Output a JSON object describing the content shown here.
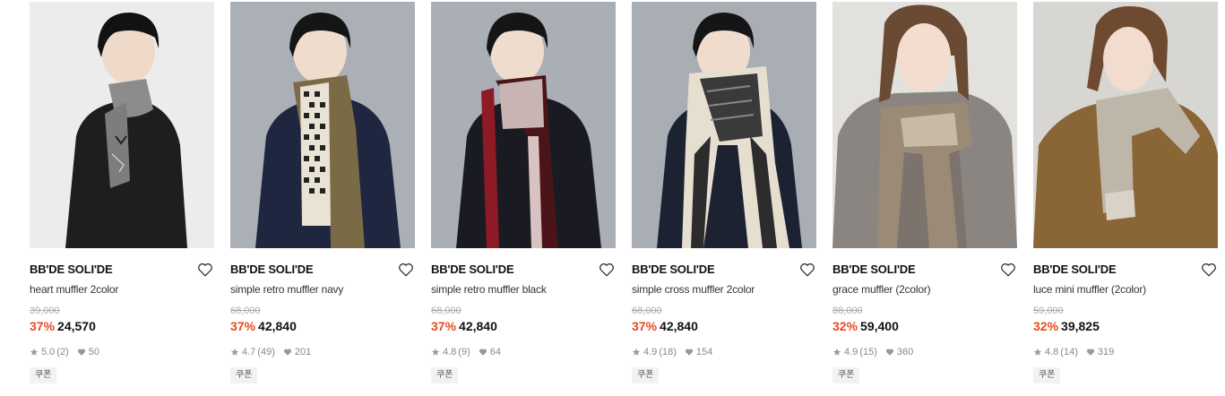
{
  "products": [
    {
      "brand": "BB'DE SOLI'DE",
      "name": "heart muffler 2color",
      "original_price": "39,000",
      "discount": "37%",
      "price": "24,570",
      "rating": "5.0",
      "review_count": "(2)",
      "likes": "50",
      "coupon": "쿠폰",
      "image_icon": "heart-muffler-photo"
    },
    {
      "brand": "BB'DE SOLI'DE",
      "name": "simple retro muffler navy",
      "original_price": "68,000",
      "discount": "37%",
      "price": "42,840",
      "rating": "4.7",
      "review_count": "(49)",
      "likes": "201",
      "coupon": "쿠폰",
      "image_icon": "retro-muffler-navy-photo"
    },
    {
      "brand": "BB'DE SOLI'DE",
      "name": "simple retro muffler black",
      "original_price": "68,000",
      "discount": "37%",
      "price": "42,840",
      "rating": "4.8",
      "review_count": "(9)",
      "likes": "64",
      "coupon": "쿠폰",
      "image_icon": "retro-muffler-black-photo"
    },
    {
      "brand": "BB'DE SOLI'DE",
      "name": "simple cross muffler 2color",
      "original_price": "68,000",
      "discount": "37%",
      "price": "42,840",
      "rating": "4.9",
      "review_count": "(18)",
      "likes": "154",
      "coupon": "쿠폰",
      "image_icon": "cross-muffler-photo"
    },
    {
      "brand": "BB'DE SOLI'DE",
      "name": "grace muffler (2color)",
      "original_price": "88,000",
      "discount": "32%",
      "price": "59,400",
      "rating": "4.9",
      "review_count": "(15)",
      "likes": "360",
      "coupon": "쿠폰",
      "image_icon": "grace-muffler-photo"
    },
    {
      "brand": "BB'DE SOLI'DE",
      "name": "luce mini muffler (2color)",
      "original_price": "59,000",
      "discount": "32%",
      "price": "39,825",
      "rating": "4.8",
      "review_count": "(14)",
      "likes": "319",
      "coupon": "쿠폰",
      "image_icon": "luce-muffler-photo"
    }
  ],
  "colors": {
    "discount": "#e8491d",
    "brand_text": "#111111",
    "meta_text": "#888888"
  }
}
